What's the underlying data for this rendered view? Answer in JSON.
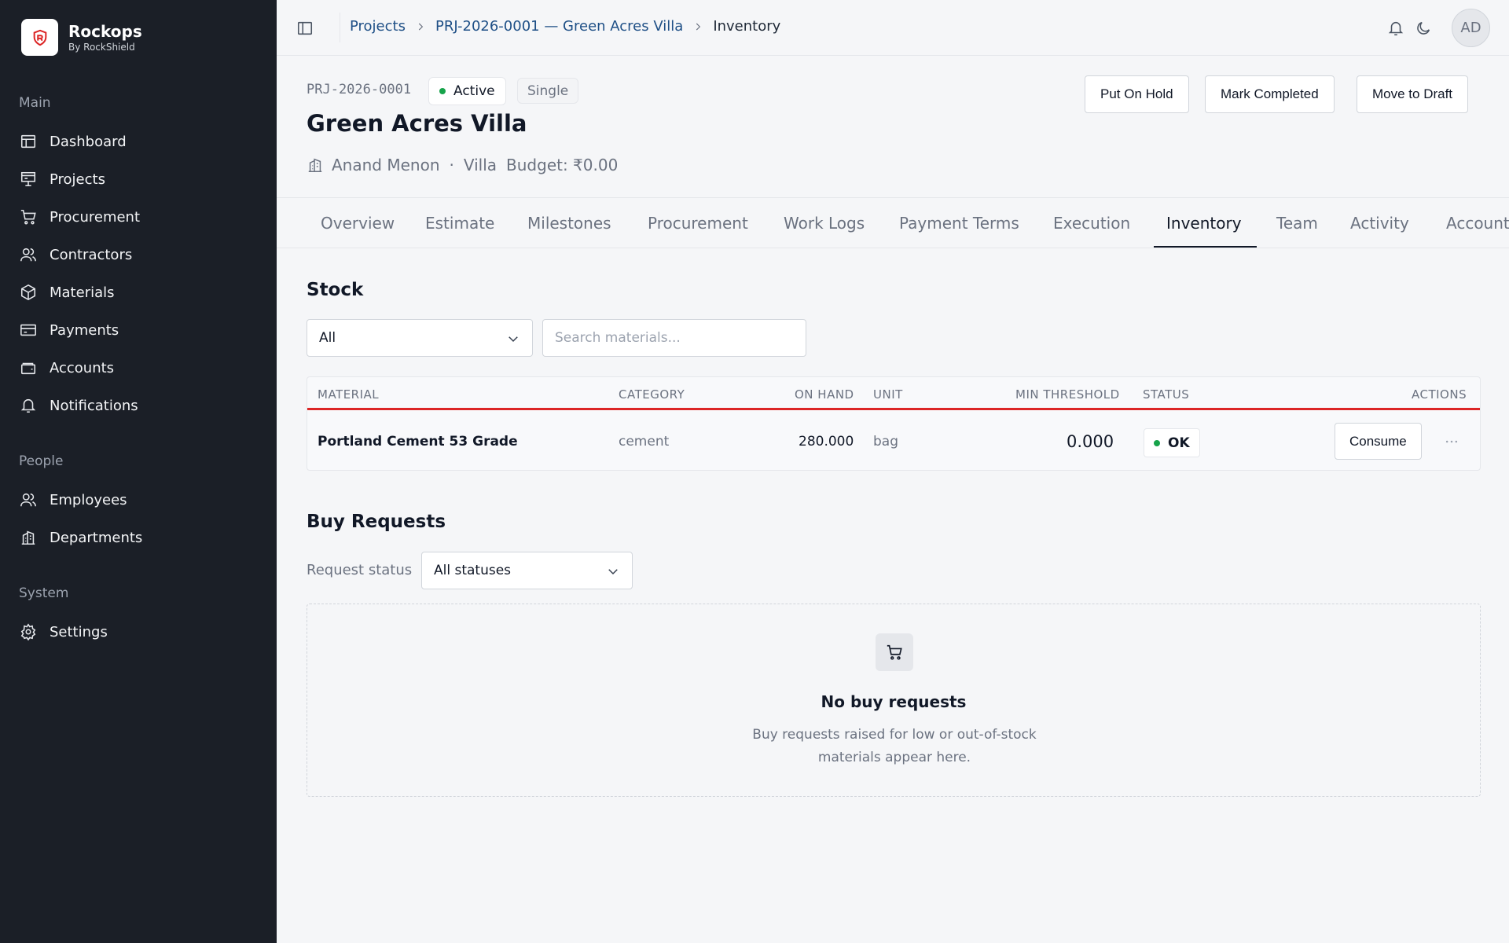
{
  "brand": {
    "name": "Rockops",
    "sub": "By RockShield"
  },
  "sidebar": {
    "sections": [
      {
        "title": "Main",
        "items": [
          {
            "label": "Dashboard",
            "icon": "dashboard-icon"
          },
          {
            "label": "Projects",
            "icon": "projects-icon"
          },
          {
            "label": "Procurement",
            "icon": "cart-icon"
          },
          {
            "label": "Contractors",
            "icon": "users-icon"
          },
          {
            "label": "Materials",
            "icon": "box-icon"
          },
          {
            "label": "Payments",
            "icon": "card-icon"
          },
          {
            "label": "Accounts",
            "icon": "wallet-icon"
          },
          {
            "label": "Notifications",
            "icon": "bell-icon"
          }
        ]
      },
      {
        "title": "People",
        "items": [
          {
            "label": "Employees",
            "icon": "users-icon"
          },
          {
            "label": "Departments",
            "icon": "building-icon"
          }
        ]
      },
      {
        "title": "System",
        "items": [
          {
            "label": "Settings",
            "icon": "gear-icon"
          }
        ]
      }
    ]
  },
  "breadcrumb": {
    "items": [
      "Projects",
      "PRJ-2026-0001 — Green Acres Villa"
    ],
    "current": "Inventory"
  },
  "user": {
    "initials": "AD"
  },
  "project": {
    "code": "PRJ-2026-0001",
    "status": "Active",
    "type": "Single",
    "title": "Green Acres Villa",
    "client": "Anand Menon",
    "category": "Villa",
    "budget": "Budget: ₹0.00"
  },
  "actions": {
    "hold": "Put On Hold",
    "complete": "Mark Completed",
    "draft": "Move to Draft"
  },
  "tabs": [
    "Overview",
    "Estimate",
    "Milestones",
    "Procurement",
    "Work Logs",
    "Payment Terms",
    "Execution",
    "Inventory",
    "Team",
    "Activity",
    "Accounts"
  ],
  "active_tab": "Inventory",
  "stock": {
    "title": "Stock",
    "filter_value": "All",
    "search_placeholder": "Search materials...",
    "columns": {
      "material": "MATERIAL",
      "category": "CATEGORY",
      "on_hand": "ON HAND",
      "unit": "UNIT",
      "min_threshold": "MIN THRESHOLD",
      "status": "STATUS",
      "actions": "ACTIONS"
    },
    "rows": [
      {
        "material": "Portland Cement 53 Grade",
        "category": "cement",
        "on_hand": "280.000",
        "unit": "bag",
        "min_threshold": "0.000",
        "status": "OK",
        "action": "Consume"
      }
    ]
  },
  "buy_requests": {
    "title": "Buy Requests",
    "filter_label": "Request status",
    "filter_value": "All statuses",
    "empty_title": "No buy requests",
    "empty_desc": "Buy requests raised for low or out-of-stock materials appear here."
  },
  "colors": {
    "sidebar_bg": "#1b1f27",
    "accent": "#1e4f86",
    "ok": "#16a34a",
    "alert": "#dc2626"
  }
}
